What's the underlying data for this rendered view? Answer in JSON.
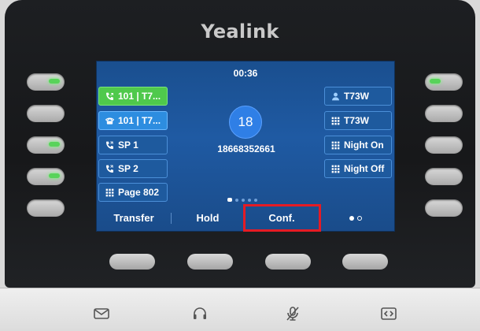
{
  "brand": "Yealink",
  "screen": {
    "timer": "00:36",
    "left_keys": [
      {
        "label": "101 | T7...",
        "icon": "phone-active-icon",
        "state": "active-green"
      },
      {
        "label": "101 | T7...",
        "icon": "desk-phone-icon",
        "state": "active-blue"
      },
      {
        "label": "SP 1",
        "icon": "phone-forward-icon",
        "state": "normal"
      },
      {
        "label": "SP 2",
        "icon": "phone-forward-icon",
        "state": "normal"
      },
      {
        "label": "Page 802",
        "icon": "grid-icon",
        "state": "normal"
      }
    ],
    "right_keys": [
      {
        "label": "T73W",
        "icon": "contact-icon"
      },
      {
        "label": "T73W",
        "icon": "grid-icon"
      },
      {
        "label": "Night On",
        "icon": "grid-icon"
      },
      {
        "label": "Night Off",
        "icon": "grid-icon"
      }
    ],
    "caller_avatar": "18",
    "caller_number": "18668352661",
    "softkeys": [
      "Transfer",
      "Hold",
      "Conf."
    ]
  },
  "colors": {
    "screen_bg": "#1f5aa3",
    "active_green": "#4fc94c",
    "active_blue": "#2d8de0",
    "highlight_box": "#e51b24",
    "led_green": "#58d35a"
  },
  "base_icons": [
    "mail-icon",
    "headset-icon",
    "mute-mic-icon",
    "transfer-arrows-icon"
  ]
}
